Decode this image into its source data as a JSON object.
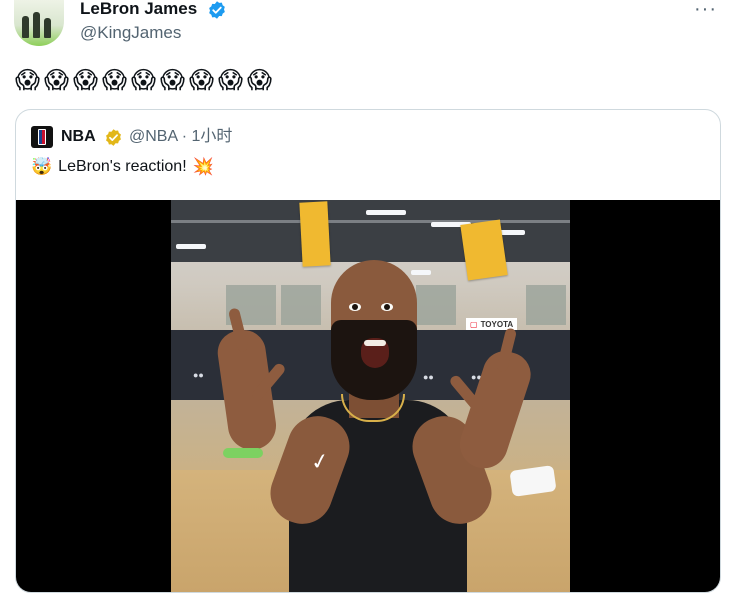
{
  "tweet": {
    "author_name": "LeBron James",
    "handle": "@KingJames",
    "more_label": "···",
    "emojis": [
      "😱",
      "😱",
      "😱",
      "😱",
      "😱",
      "😱",
      "😱",
      "😱",
      "😱"
    ]
  },
  "quote": {
    "name": "NBA",
    "handle_time": "@NBA · 1小时",
    "text": "LeBron's reaction!",
    "leading_emoji": "🤯",
    "trailing_emoji": "💥"
  },
  "video": {
    "sponsor": "TOYOTA"
  },
  "colors": {
    "verified_blue": "#1d9bf0",
    "gold_badge": "#e2b719",
    "secondary_text": "#536471",
    "border": "#cfd9de"
  }
}
